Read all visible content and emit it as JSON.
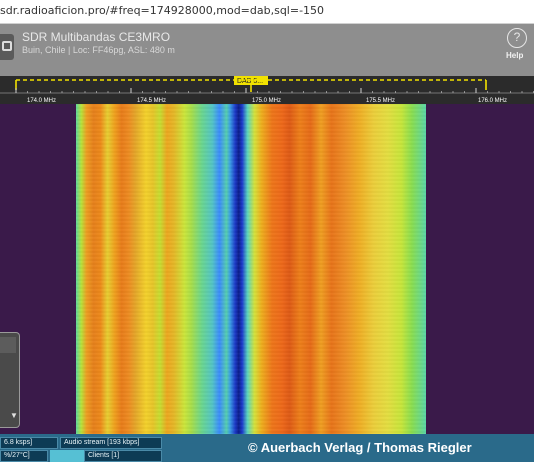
{
  "browser": {
    "url": "sdr.radioaficion.pro/#freq=174928000,mod=dab,sql=-150"
  },
  "header": {
    "title": "SDR Multibandas CE3MRO",
    "subtitle": "Buin, Chile | Loc: FF46pg, ASL: 480 m",
    "links": [
      "",
      "",
      "",
      ""
    ],
    "help_label": "Help"
  },
  "scale": {
    "tuner_label": "DAB 5...",
    "ticks": [
      "174.0 MHz",
      "174.5 MHz",
      "175.0 MHz",
      "175.5 MHz",
      "176.0 MHz"
    ],
    "colors": {
      "accent": "#f2e200",
      "background": "#2b2b2b"
    }
  },
  "status": {
    "audio_buffer": "6.8 ksps]",
    "audio_stream": "Audio stream [193 kbps]",
    "cpu": "%/27°C]",
    "clients": "Clients [1]"
  },
  "credit": "© Auerbach Verlag / Thomas Riegler",
  "colors": {
    "waterfall_background": "#3a1a4a",
    "status_bar": "#2a6a8a"
  }
}
